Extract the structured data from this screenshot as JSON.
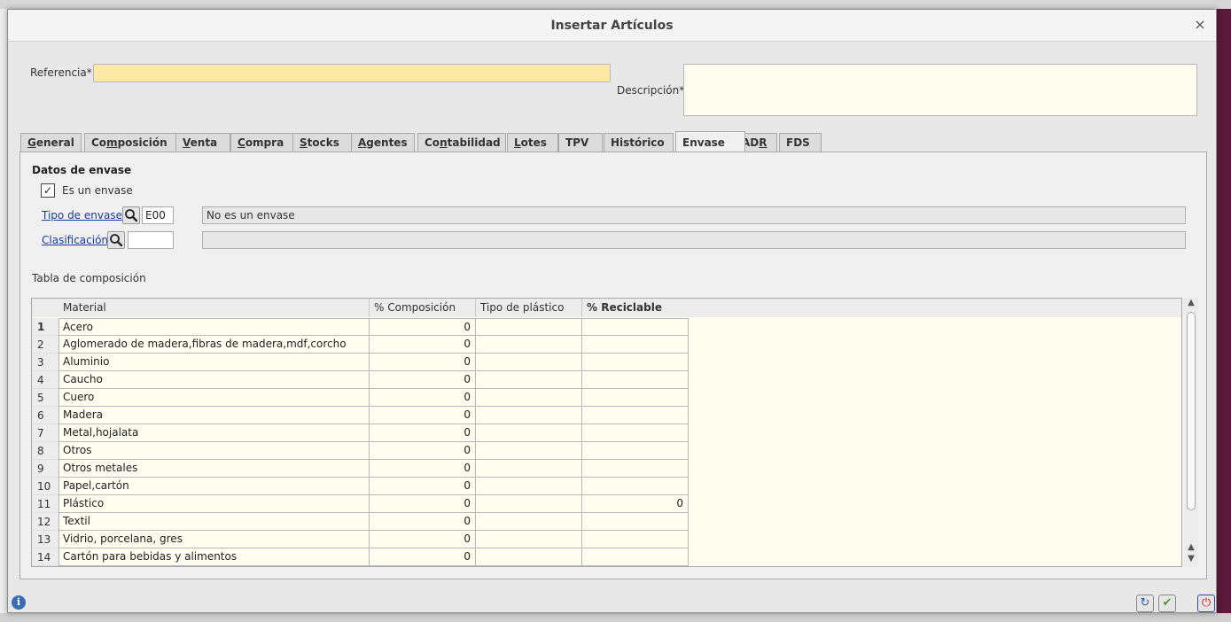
{
  "dialog": {
    "title": "Insertar Artículos",
    "close_symbol": "×"
  },
  "form": {
    "referencia_label": "Referencia*",
    "referencia_value": "",
    "descripcion_label": "Descripción*",
    "descripcion_value": ""
  },
  "tabs": [
    {
      "pre": "",
      "u": "G",
      "post": "eneral"
    },
    {
      "pre": "Co",
      "u": "m",
      "post": "posición"
    },
    {
      "pre": "",
      "u": "V",
      "post": "enta"
    },
    {
      "pre": "",
      "u": "C",
      "post": "ompra"
    },
    {
      "pre": "",
      "u": "S",
      "post": "tocks"
    },
    {
      "pre": "",
      "u": "A",
      "post": "gentes"
    },
    {
      "pre": "Co",
      "u": "n",
      "post": "tabilidad"
    },
    {
      "pre": "",
      "u": "L",
      "post": "otes"
    },
    {
      "pre": "TPV",
      "u": "",
      "post": ""
    },
    {
      "pre": "Histórico",
      "u": "",
      "post": ""
    },
    {
      "pre": "Envase",
      "u": "",
      "post": ""
    },
    {
      "pre": "AD",
      "u": "R",
      "post": ""
    },
    {
      "pre": "FDS",
      "u": "",
      "post": ""
    }
  ],
  "active_tab": "Envase",
  "envase": {
    "section_title": "Datos de envase",
    "es_envase_label": "Es un envase",
    "es_envase_checked": true,
    "check_mark": "✓",
    "tipo_label": "Tipo de envase",
    "tipo_code": "E00",
    "tipo_desc": "No es un envase",
    "clasificacion_label": "Clasificación",
    "clasificacion_code": "",
    "clasificacion_desc": ""
  },
  "table": {
    "caption": "Tabla de composición",
    "headers": [
      "Material",
      "% Composición",
      "Tipo de plástico",
      "% Reciclable"
    ],
    "rows": [
      {
        "n": "1",
        "material": "Acero",
        "composicion": "0",
        "tipo_plastico": "",
        "reciclable": ""
      },
      {
        "n": "2",
        "material": "Aglomerado de madera,fibras de madera,mdf,corcho",
        "composicion": "0",
        "tipo_plastico": "",
        "reciclable": ""
      },
      {
        "n": "3",
        "material": "Aluminio",
        "composicion": "0",
        "tipo_plastico": "",
        "reciclable": ""
      },
      {
        "n": "4",
        "material": "Caucho",
        "composicion": "0",
        "tipo_plastico": "",
        "reciclable": ""
      },
      {
        "n": "5",
        "material": "Cuero",
        "composicion": "0",
        "tipo_plastico": "",
        "reciclable": ""
      },
      {
        "n": "6",
        "material": "Madera",
        "composicion": "0",
        "tipo_plastico": "",
        "reciclable": ""
      },
      {
        "n": "7",
        "material": "Metal,hojalata",
        "composicion": "0",
        "tipo_plastico": "",
        "reciclable": ""
      },
      {
        "n": "8",
        "material": "Otros",
        "composicion": "0",
        "tipo_plastico": "",
        "reciclable": ""
      },
      {
        "n": "9",
        "material": "Otros metales",
        "composicion": "0",
        "tipo_plastico": "",
        "reciclable": ""
      },
      {
        "n": "10",
        "material": "Papel,cartón",
        "composicion": "0",
        "tipo_plastico": "",
        "reciclable": ""
      },
      {
        "n": "11",
        "material": "Plástico",
        "composicion": "0",
        "tipo_plastico": "",
        "reciclable": "0"
      },
      {
        "n": "12",
        "material": "Textil",
        "composicion": "0",
        "tipo_plastico": "",
        "reciclable": ""
      },
      {
        "n": "13",
        "material": "Vidrio, porcelana, gres",
        "composicion": "0",
        "tipo_plastico": "",
        "reciclable": ""
      },
      {
        "n": "14",
        "material": "Cartón para bebidas y alimentos",
        "composicion": "0",
        "tipo_plastico": "",
        "reciclable": ""
      }
    ]
  },
  "footer": {
    "info_symbol": "i",
    "refresh_symbol": "↻",
    "accept_symbol": "✔",
    "exit_symbol": "⏻"
  },
  "colors": {
    "required_field": "#fde8a8",
    "link": "#1a3aa8",
    "grid_bg": "#fffdf0"
  }
}
